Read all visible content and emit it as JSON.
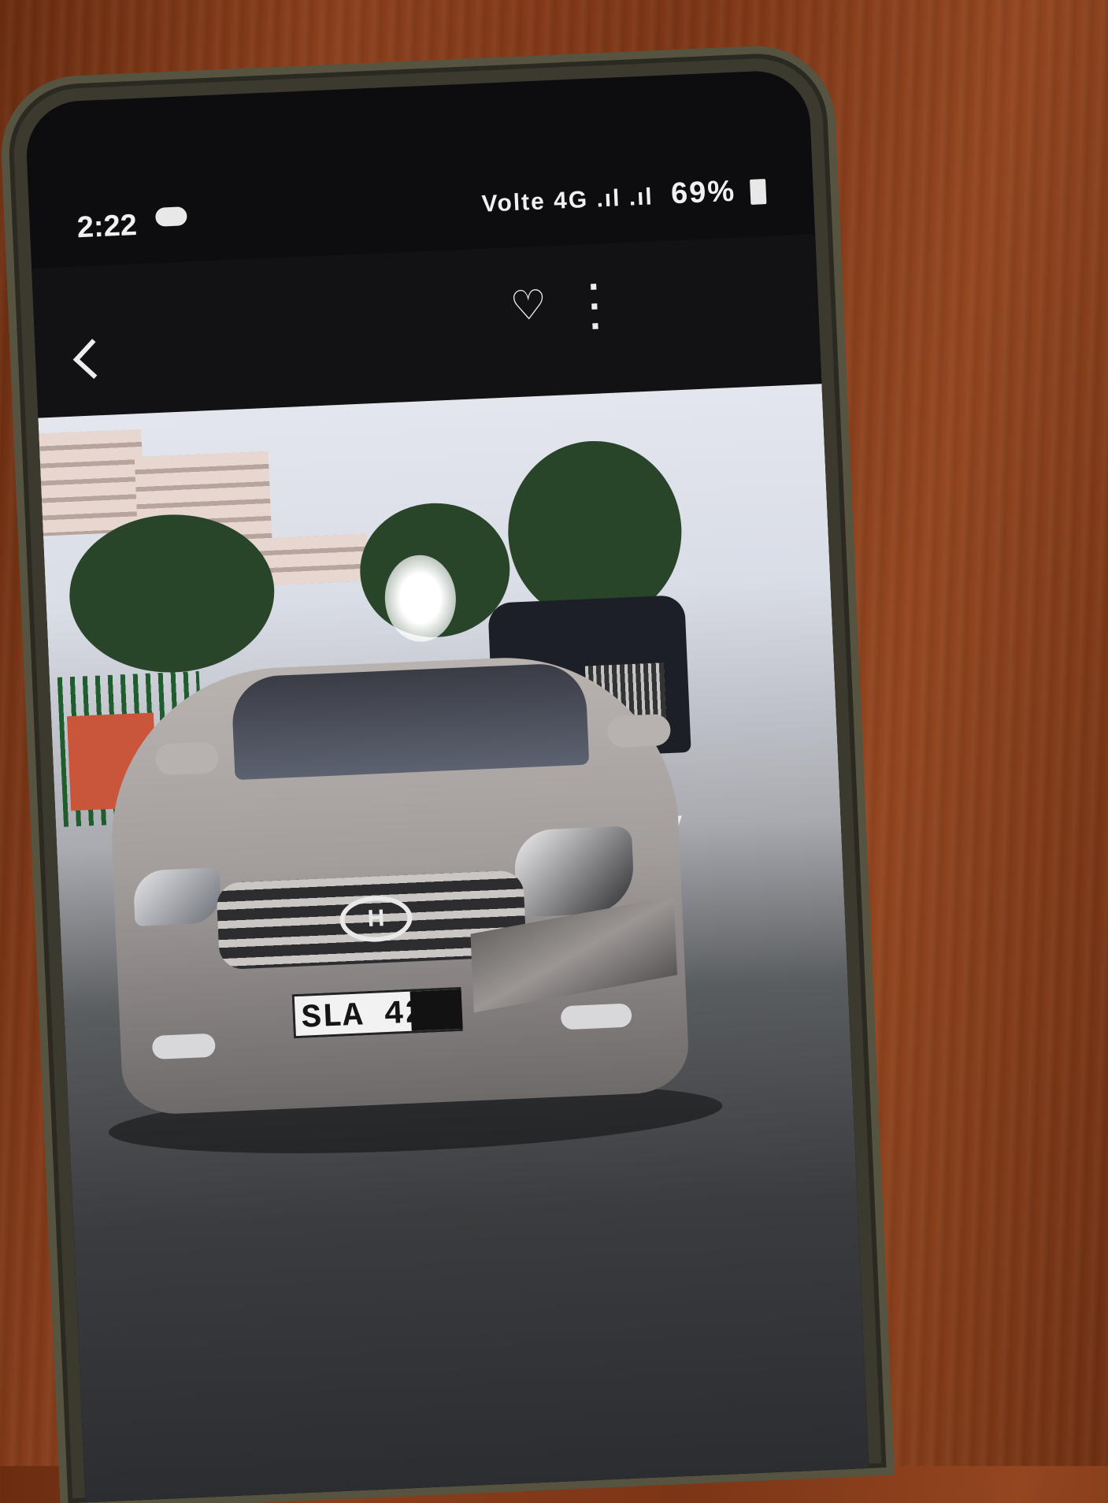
{
  "status_bar": {
    "time": "2:22",
    "signal_text": "Volte 4G .ıl .ıl",
    "battery": "69%"
  },
  "photo": {
    "license_plate": "SLA 429"
  },
  "colors": {
    "table": "#7c3516",
    "phone_frame": "#565340",
    "screen": "#0d0d10",
    "car": "#a39e9c"
  }
}
